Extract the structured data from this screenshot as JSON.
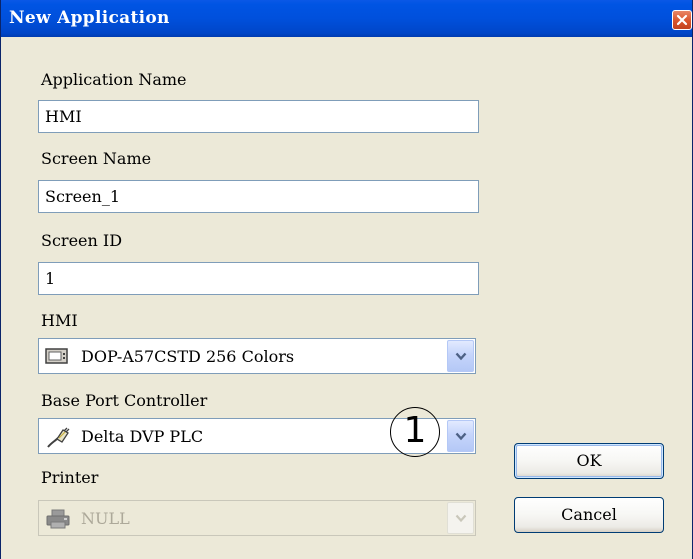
{
  "window": {
    "title": "New Application"
  },
  "fields": {
    "app_name_label": "Application Name",
    "app_name_value": "HMI",
    "screen_name_label": "Screen Name",
    "screen_name_value": "Screen_1",
    "screen_id_label": "Screen ID",
    "screen_id_value": "1",
    "hmi_label": "HMI",
    "hmi_value": "DOP-A57CSTD 256 Colors",
    "base_port_label": "Base Port Controller",
    "base_port_value": "Delta DVP PLC",
    "printer_label": "Printer",
    "printer_value": "NULL"
  },
  "buttons": {
    "ok": "OK",
    "cancel": "Cancel"
  },
  "annotation": {
    "callout": "1"
  },
  "icons": {
    "close": "close-icon",
    "hmi": "monitor-icon",
    "controller": "cable-connector-icon",
    "printer": "printer-icon",
    "dropdown": "chevron-down-icon"
  },
  "colors": {
    "titlebar": "#0054e3",
    "dialog_bg": "#ece9d8",
    "close_button": "#d9542c",
    "input_border": "#7f9db9",
    "dropdown_arrow": "#4d6185"
  }
}
